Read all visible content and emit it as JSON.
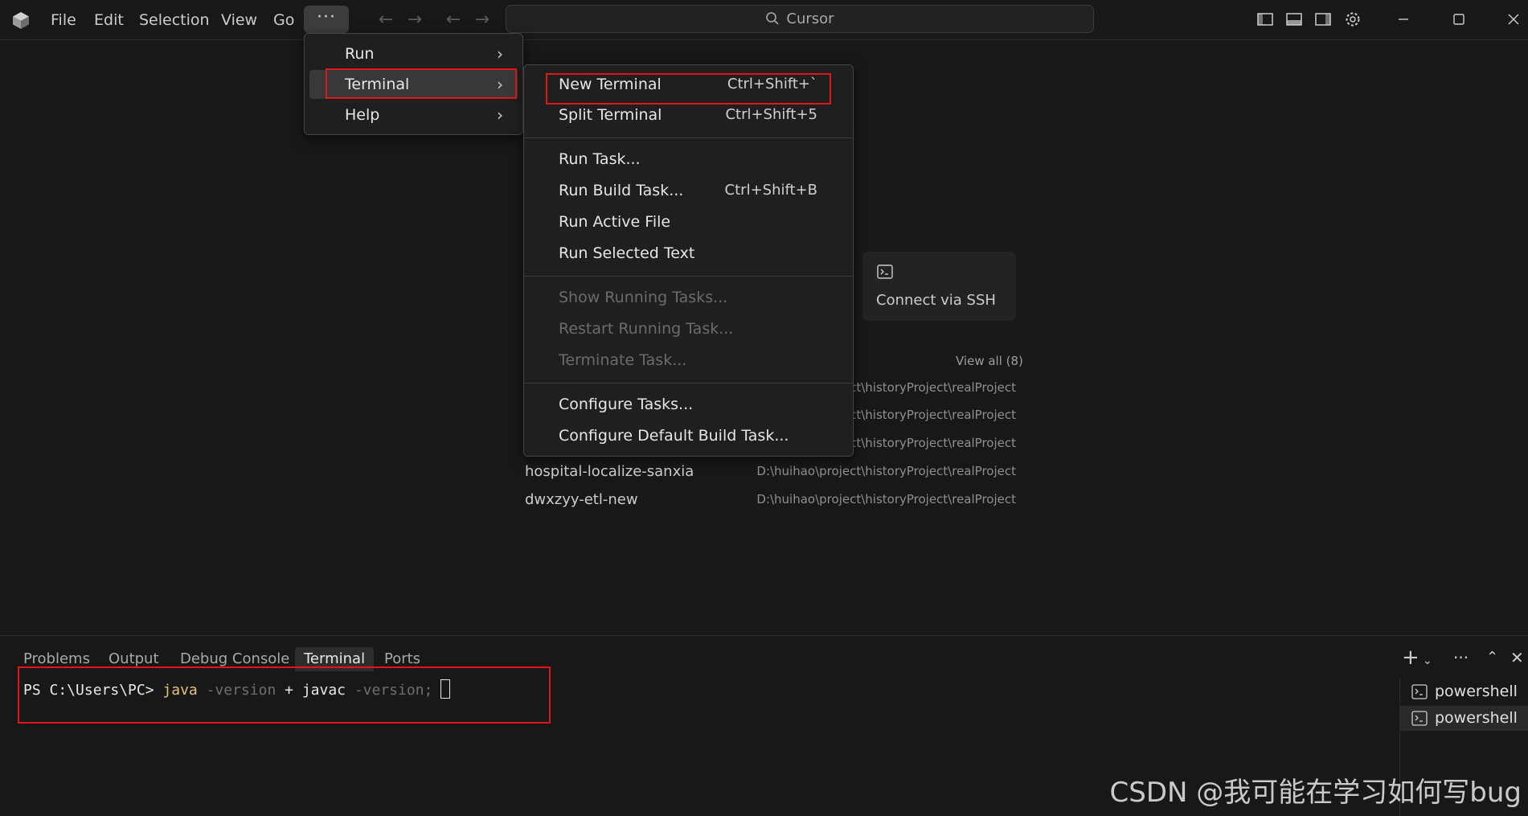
{
  "titlebar": {
    "menus": [
      "File",
      "Edit",
      "Selection",
      "View",
      "Go"
    ],
    "more": "···",
    "search_text": "Cursor"
  },
  "menu_main": {
    "items": [
      {
        "label": "Run",
        "chevron": "›"
      },
      {
        "label": "Terminal",
        "chevron": "›"
      },
      {
        "label": "Help",
        "chevron": "›"
      }
    ]
  },
  "menu_terminal": {
    "groups": [
      [
        {
          "label": "New Terminal",
          "shortcut": "Ctrl+Shift+`",
          "enabled": true
        },
        {
          "label": "Split Terminal",
          "shortcut": "Ctrl+Shift+5",
          "enabled": true
        }
      ],
      [
        {
          "label": "Run Task...",
          "shortcut": "",
          "enabled": true
        },
        {
          "label": "Run Build Task...",
          "shortcut": "Ctrl+Shift+B",
          "enabled": true
        },
        {
          "label": "Run Active File",
          "shortcut": "",
          "enabled": true
        },
        {
          "label": "Run Selected Text",
          "shortcut": "",
          "enabled": true
        }
      ],
      [
        {
          "label": "Show Running Tasks...",
          "shortcut": "",
          "enabled": false
        },
        {
          "label": "Restart Running Task...",
          "shortcut": "",
          "enabled": false
        },
        {
          "label": "Terminate Task...",
          "shortcut": "",
          "enabled": false
        }
      ],
      [
        {
          "label": "Configure Tasks...",
          "shortcut": "",
          "enabled": true
        },
        {
          "label": "Configure Default Build Task...",
          "shortcut": "",
          "enabled": true
        }
      ]
    ]
  },
  "welcome": {
    "ssh_label": "Connect via SSH",
    "view_all": "View all (8)",
    "recent": [
      {
        "name": "",
        "path": "oject\\historyProject\\realProject"
      },
      {
        "name": "",
        "path": "oject\\historyProject\\realProject"
      },
      {
        "name": "",
        "path": "oject\\historyProject\\realProject"
      },
      {
        "name": "hospital-localize-sanxia",
        "path": "D:\\huihao\\project\\historyProject\\realProject"
      },
      {
        "name": "dwxzyy-etl-new",
        "path": "D:\\huihao\\project\\historyProject\\realProject"
      }
    ]
  },
  "panel": {
    "tabs": [
      "Problems",
      "Output",
      "Debug Console",
      "Terminal",
      "Ports"
    ],
    "active_tab": "Terminal",
    "terminal": {
      "prompt": "PS C:\\Users\\PC> ",
      "cmd1": "java",
      "arg1": " -version ",
      "op": "+ ",
      "cmd2": "javac",
      "arg2": " -version;"
    },
    "shells": [
      "powershell",
      "powershell"
    ]
  },
  "watermark": "CSDN @我可能在学习如何写bug",
  "colors": {
    "accent_red": "#e0161e",
    "bg": "#181818",
    "menu_bg": "#1f1f1f"
  }
}
